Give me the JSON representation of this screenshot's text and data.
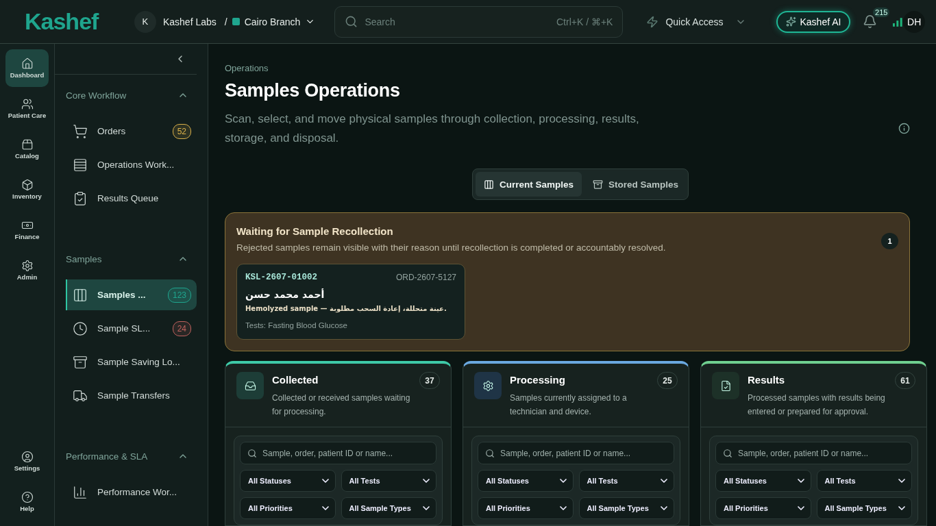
{
  "header": {
    "logo": "Kashef",
    "org_initial": "K",
    "org": "Kashef Labs",
    "separator": "/",
    "branch": "Cairo Branch",
    "search_placeholder": "Search",
    "shortcut": "Ctrl+K / ⌘+K",
    "quick_access": "Quick Access",
    "ai_button": "Kashef AI",
    "notifications": "215",
    "user_initials": "DH"
  },
  "rail": [
    {
      "label": "Dashboard",
      "selected": true
    },
    {
      "label": "Patient Care",
      "selected": false
    },
    {
      "label": "Catalog",
      "selected": false
    },
    {
      "label": "Inventory",
      "selected": false
    },
    {
      "label": "Finance",
      "selected": false
    },
    {
      "label": "Admin",
      "selected": false
    }
  ],
  "rail_bottom": [
    {
      "label": "Settings"
    },
    {
      "label": "Help"
    }
  ],
  "sidebar": [
    {
      "title": "Core Workflow",
      "expanded": true,
      "items": [
        {
          "label": "Orders",
          "badge": "52",
          "color": "#d9b04a",
          "selected": false
        },
        {
          "label": "Operations Work...",
          "selected": false
        },
        {
          "label": "Results Queue",
          "selected": false
        }
      ]
    },
    {
      "title": "Samples",
      "expanded": true,
      "items": [
        {
          "label": "Samples ...",
          "badge": "123",
          "color": "#1fa58e",
          "selected": true
        },
        {
          "label": "Sample SL...",
          "badge": "24",
          "color": "#c0625e",
          "selected": false
        },
        {
          "label": "Sample Saving Lo...",
          "selected": false
        },
        {
          "label": "Sample Transfers",
          "selected": false
        }
      ]
    },
    {
      "title": "Performance & SLA",
      "expanded": true,
      "items": [
        {
          "label": "Performance Wor...",
          "selected": false
        }
      ]
    }
  ],
  "breadcrumb": "Operations",
  "title": "Samples Operations",
  "description": "Scan, select, and move physical samples through collection, processing, results, storage, and disposal.",
  "view_tabs": [
    {
      "label": "Current Samples",
      "selected": true
    },
    {
      "label": "Stored Samples",
      "selected": false
    }
  ],
  "recollection": {
    "title": "Waiting for Sample Recollection",
    "description": "Rejected samples remain visible with their reason until recollection is completed or accountably resolved.",
    "count": "1",
    "samples": [
      {
        "sample_id": "KSL-2607-01002",
        "order_id": "ORD-2607-5127",
        "patient": "أحمد محمد حسن",
        "reason": "Hemolyzed sample — عينة متحللة، إعادة السحب مطلوبة.",
        "tests": "Tests: Fasting Blood Glucose"
      }
    ]
  },
  "columns": [
    {
      "kind": "collected",
      "title": "Collected",
      "description": "Collected or received samples waiting for processing.",
      "count": "37",
      "color": "#3ec9a7",
      "search_placeholder": "Sample, order, patient ID or name...",
      "filters": [
        "All Statuses",
        "All Tests",
        "All Priorities",
        "All Sample Types"
      ]
    },
    {
      "kind": "processing",
      "title": "Processing",
      "description": "Samples currently assigned to a technician and device.",
      "count": "25",
      "color": "#6aa8e0",
      "search_placeholder": "Sample, order, patient ID or name...",
      "filters": [
        "All Statuses",
        "All Tests",
        "All Priorities",
        "All Sample Types"
      ]
    },
    {
      "kind": "results",
      "title": "Results",
      "description": "Processed samples with results being entered or prepared for approval.",
      "count": "61",
      "color": "#6fcf8f",
      "search_placeholder": "Sample, order, patient ID or name...",
      "filters": [
        "All Statuses",
        "All Tests",
        "All Priorities",
        "All Sample Types"
      ]
    }
  ]
}
